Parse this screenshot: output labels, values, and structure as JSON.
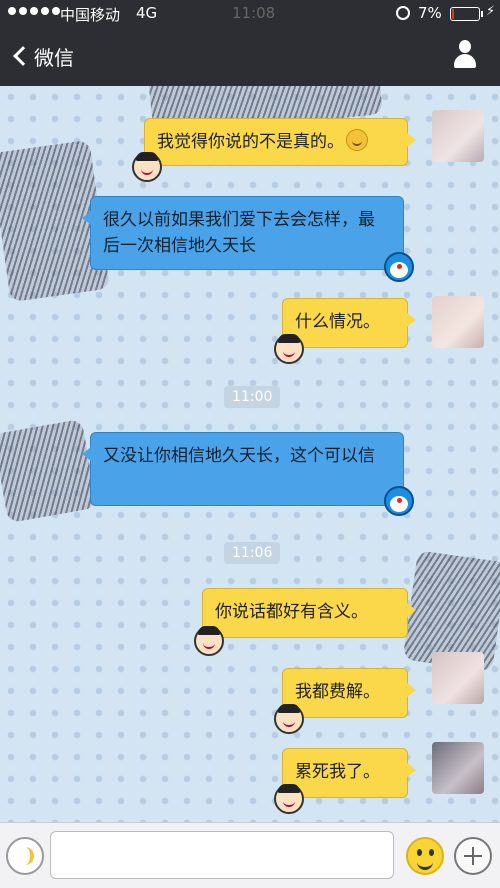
{
  "status_bar": {
    "carrier": "中国移动",
    "network": "4G",
    "time": "11:08",
    "battery": "7%",
    "battery_level": 0.07,
    "battery_color": "#e5322d"
  },
  "nav": {
    "back_label": "微信",
    "back_icon": "chevron-left-icon",
    "profile_icon": "user-icon"
  },
  "messages": [
    {
      "side": "me",
      "text": "我觉得你说的不是真的。",
      "emoji": "smile-emoji"
    },
    {
      "side": "them",
      "text": "很久以前如果我们爱下去会怎样，最后一次相信地久天长"
    },
    {
      "side": "me",
      "text": "什么情况。"
    },
    {
      "type": "timestamp",
      "text": "11:00"
    },
    {
      "side": "them",
      "text": "又没让你相信地久天长，这个可以信"
    },
    {
      "type": "timestamp",
      "text": "11:06"
    },
    {
      "side": "me",
      "text": "你说话都好有含义。"
    },
    {
      "side": "me",
      "text": "我都费解。"
    },
    {
      "side": "me",
      "text": "累死我了。"
    }
  ],
  "colors": {
    "my_bubble": "#fbd84a",
    "their_bubble": "#4aa3e8",
    "nav_background": "#2d2e33",
    "chat_background": "#d3e4f2"
  },
  "input_bar": {
    "voice_icon": "voice-icon",
    "emoji_icon": "emoji-icon",
    "plus_icon": "plus-icon",
    "input_value": ""
  }
}
